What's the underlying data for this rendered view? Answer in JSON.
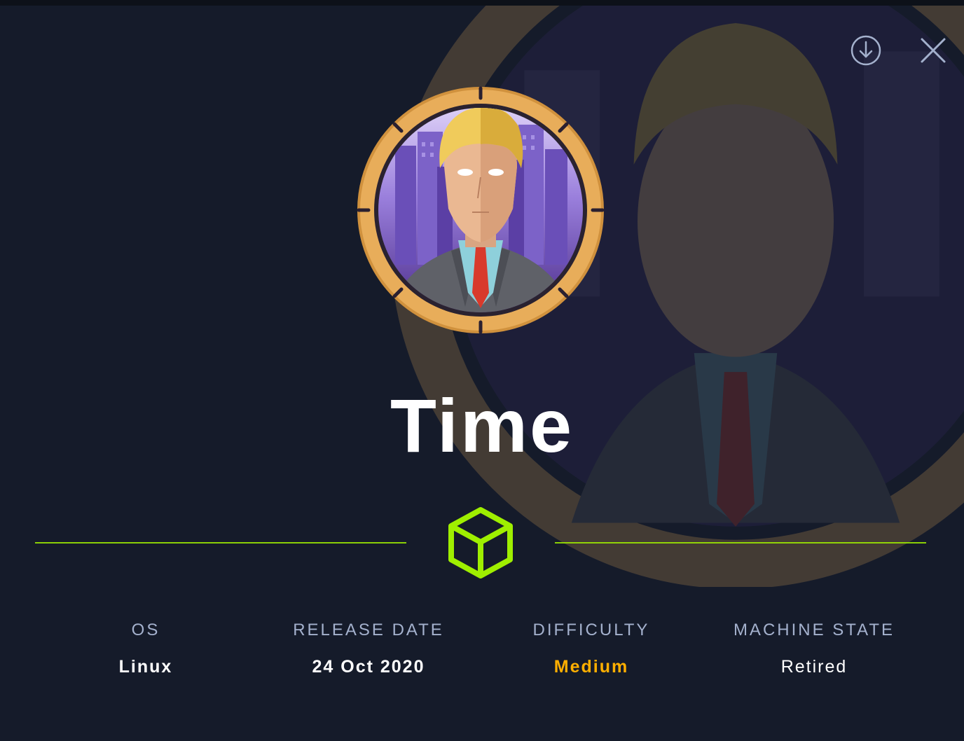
{
  "machine": {
    "name": "Time",
    "os_icon": "cube-icon"
  },
  "header": {
    "download_icon": "download-icon",
    "close_icon": "close-icon"
  },
  "stats": [
    {
      "label": "OS",
      "value": "Linux"
    },
    {
      "label": "RELEASE DATE",
      "value": "24 Oct 2020"
    },
    {
      "label": "DIFFICULTY",
      "value": "Medium"
    },
    {
      "label": "MACHINE STATE",
      "value": "Retired"
    }
  ],
  "colors": {
    "background": "#151b2a",
    "accent_green": "#9fef00",
    "difficulty_medium": "#ffaf00",
    "avatar_ring": "#e8ad5a",
    "label_gray": "#a4b1cd"
  }
}
